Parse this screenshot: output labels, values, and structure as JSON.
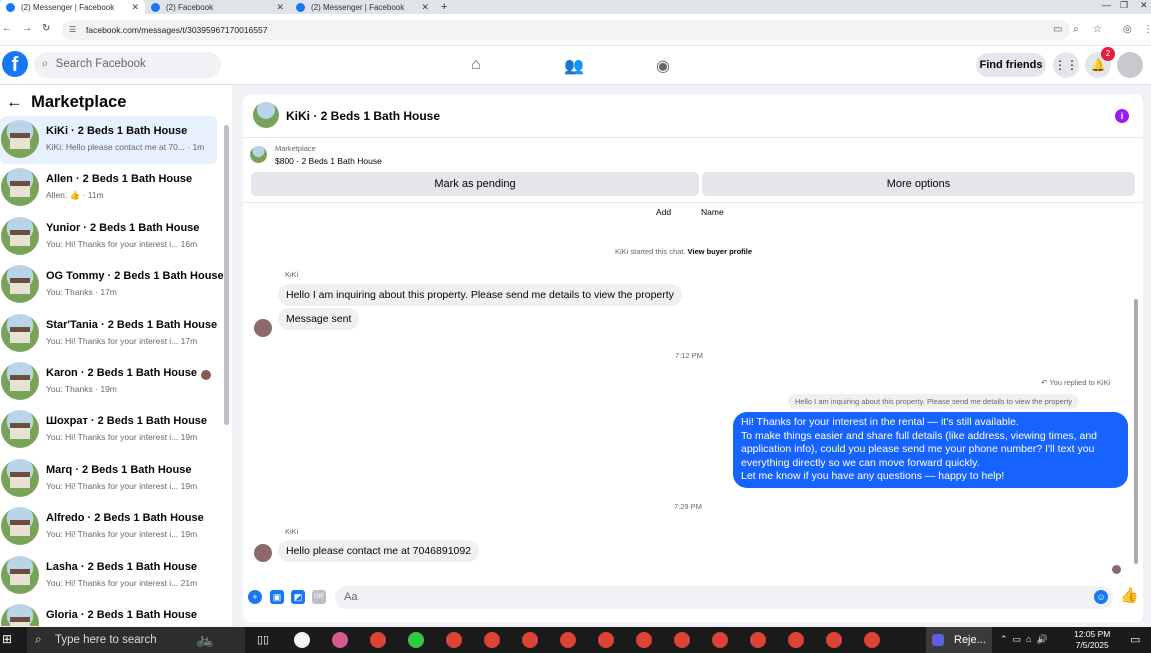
{
  "browser": {
    "tabs": [
      {
        "title": "(2) Messenger | Facebook",
        "active": true
      },
      {
        "title": "(2) Facebook",
        "active": false
      },
      {
        "title": "(2) Messenger | Facebook",
        "active": false
      }
    ],
    "url": "facebook.com/messages/t/30395967170016557"
  },
  "header": {
    "search_placeholder": "Search Facebook",
    "find_friends": "Find friends",
    "notif_count": "2"
  },
  "sidebar": {
    "title": "Marketplace",
    "conversations": [
      {
        "name": "KiKi · 2 Beds 1 Bath House",
        "preview": "KiKi: Hello please contact me at 70... · 1m",
        "selected": true
      },
      {
        "name": "Allen · 2 Beds 1 Bath House",
        "preview": "Allen: 👍 · 11m"
      },
      {
        "name": "Yunior · 2 Beds 1 Bath House",
        "preview": "You: Hi! Thanks for your interest i...  16m"
      },
      {
        "name": "OG Tommy · 2 Beds 1 Bath House",
        "preview": "You: Thanks · 17m"
      },
      {
        "name": "Star'Tania · 2 Beds 1 Bath House",
        "preview": "You: Hi! Thanks for your interest i...  17m"
      },
      {
        "name": "Karon · 2 Beds 1 Bath House",
        "preview": "You: Thanks · 19m"
      },
      {
        "name": "Шохрат · 2 Beds 1 Bath House",
        "preview": "You: Hi! Thanks for your interest i...  19m"
      },
      {
        "name": "Marq · 2 Beds 1 Bath House",
        "preview": "You: Hi! Thanks for your interest i...  19m"
      },
      {
        "name": "Alfredo · 2 Beds 1 Bath House",
        "preview": "You: Hi! Thanks for your interest i...  19m"
      },
      {
        "name": "Lasha · 2 Beds 1 Bath House",
        "preview": "You: Hi! Thanks for your interest i...  21m"
      },
      {
        "name": "Gloria · 2 Beds 1 Bath House",
        "preview": ""
      }
    ]
  },
  "chat": {
    "title": "KiKi · 2 Beds 1 Bath House",
    "marketplace_label": "Marketplace",
    "listing": "$800 - 2 Beds 1 Bath House",
    "mark_pending": "Mark as pending",
    "more_options": "More options",
    "add_label": "Add",
    "name_label": "Name",
    "started_text": "KiKi started this chat.",
    "view_profile": "View buyer profile",
    "sender_name": "KiKi",
    "msg1": "Hello I am inquiring about this property. Please send me details to view the property",
    "msg2": "Message sent",
    "time1": "7:12 PM",
    "replied_to": "You replied to KiKi",
    "quoted": "Hello I am inquiring about this property. Please send me details to view the property",
    "reply_lines": [
      "Hi! Thanks for your interest in the rental — it's still available.",
      "To make things easier and share full details (like address, viewing times, and",
      "application info), could you please send me your phone number? I'll text you",
      "everything directly so we can move forward quickly.",
      "Let me know if you have any questions — happy to help!"
    ],
    "time2": "7:29 PM",
    "msg3": "Hello please contact me at 7046891092",
    "composer_placeholder": "Aa"
  },
  "taskbar": {
    "search_placeholder": "Type here to search",
    "active_app": "Reje...",
    "time": "12:05 PM",
    "date": "7/5/2025"
  },
  "colors": {
    "brand": "#1877f2",
    "bubble_blue": "#1763ff",
    "notif_red": "#e41e3f"
  }
}
